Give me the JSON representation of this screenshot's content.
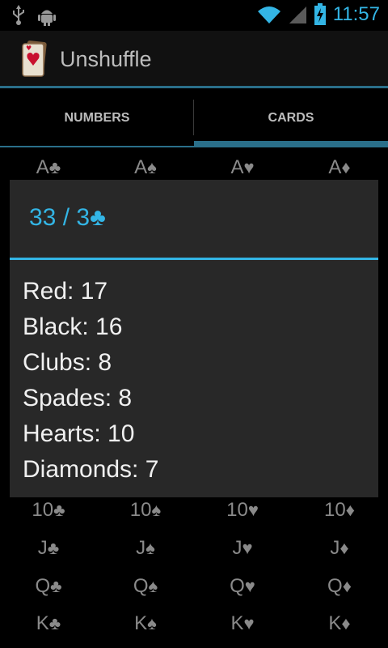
{
  "status_bar": {
    "time": "11:57"
  },
  "action_bar": {
    "title": "Unshuffle"
  },
  "tabs": [
    {
      "label": "NUMBERS"
    },
    {
      "label": "CARDS",
      "selected": true
    }
  ],
  "grid": {
    "rows": [
      {
        "cells": [
          {
            "rank": "A",
            "suit": "♣"
          },
          {
            "rank": "A",
            "suit": "♠"
          },
          {
            "rank": "A",
            "suit": "♥"
          },
          {
            "rank": "A",
            "suit": "♦"
          }
        ]
      },
      {
        "cells": [
          {
            "rank": "10",
            "suit": "♣"
          },
          {
            "rank": "10",
            "suit": "♠"
          },
          {
            "rank": "10",
            "suit": "♥"
          },
          {
            "rank": "10",
            "suit": "♦"
          }
        ]
      },
      {
        "cells": [
          {
            "rank": "J",
            "suit": "♣"
          },
          {
            "rank": "J",
            "suit": "♠"
          },
          {
            "rank": "J",
            "suit": "♥"
          },
          {
            "rank": "J",
            "suit": "♦"
          }
        ]
      },
      {
        "cells": [
          {
            "rank": "Q",
            "suit": "♣"
          },
          {
            "rank": "Q",
            "suit": "♠"
          },
          {
            "rank": "Q",
            "suit": "♥"
          },
          {
            "rank": "Q",
            "suit": "♦"
          }
        ]
      },
      {
        "cells": [
          {
            "rank": "K",
            "suit": "♣"
          },
          {
            "rank": "K",
            "suit": "♠"
          },
          {
            "rank": "K",
            "suit": "♥"
          },
          {
            "rank": "K",
            "suit": "♦"
          }
        ]
      }
    ]
  },
  "dialog": {
    "title": "33 / 3",
    "title_suit": "♣",
    "stats": [
      {
        "text": "Red: 17"
      },
      {
        "text": "Black: 16"
      },
      {
        "text": "Clubs: 8"
      },
      {
        "text": "Spades: 8"
      },
      {
        "text": "Hearts: 10"
      },
      {
        "text": "Diamonds: 7"
      }
    ]
  },
  "icons": {
    "usb": "usb-icon",
    "android": "android-debug-icon",
    "wifi": "wifi-icon",
    "signal": "signal-icon",
    "battery": "battery-charging-icon",
    "app": "app-card-icon"
  },
  "colors": {
    "accent": "#33b5e5",
    "tab_indicator": "#2a6f8a",
    "dialog_bg": "#282828"
  }
}
